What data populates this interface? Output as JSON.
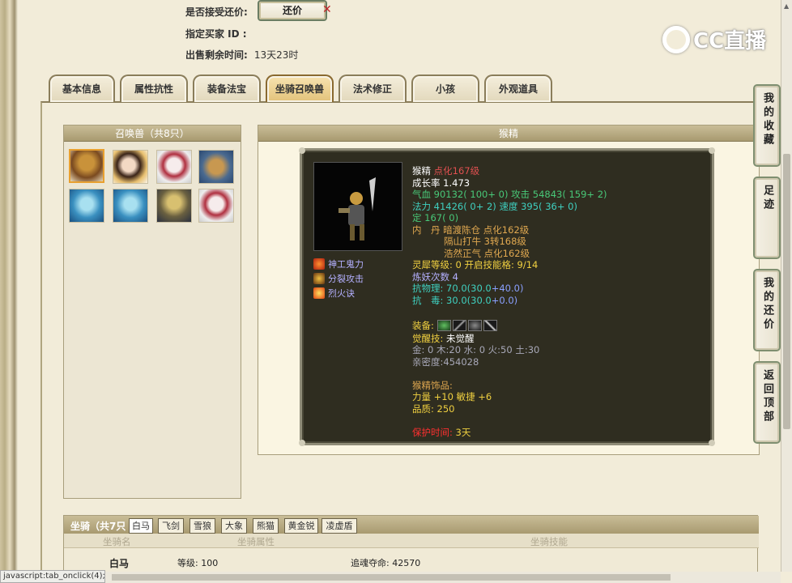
{
  "top": {
    "accept_bargain_label": "是否接受还价:",
    "bargain_button": "还价",
    "buyer_label": "指定买家 ID :",
    "remaining_label": "出售剩余时间:",
    "remaining_value": "13天23时"
  },
  "logo": {
    "text": "CC直播"
  },
  "tabs": [
    "基本信息",
    "属性抗性",
    "装备法宝",
    "坐骑召唤兽",
    "法术修正",
    "小孩",
    "外观道具"
  ],
  "active_tab": "坐骑召唤兽",
  "pet_list": {
    "title": "召唤兽（共8只）"
  },
  "detail": {
    "title": "猴精",
    "skills": [
      "神工鬼力",
      "分裂攻击",
      "烈火诀"
    ],
    "name": "猴精",
    "name_suffix": "点化167级",
    "growth": "成长率 1.473",
    "hp_label": "气血 ",
    "hp_value": "90132( 100+ 0)",
    "atk_label": " 攻击 ",
    "atk_value": "54843( 159+ 2)",
    "mp_label": "法力 ",
    "mp_value": "41426( 0+ 2)",
    "spd_label": " 速度 ",
    "spd_value": "395( 36+ 0)",
    "ding_label": "定 ",
    "ding_value": "167( 0)",
    "neidan_label": "内　丹 ",
    "neidan_1": "暗渡陈仓 点化162级",
    "neidan_2": "隔山打牛 3转168级",
    "neidan_3": "浩然正气 点化162级",
    "lingxi": "灵犀等级:  0 开启技能格:  9/14",
    "lianyao": "炼妖次数 4",
    "kangwuli_label": "抗物理: ",
    "kangwuli_base": "70.0(30.0",
    "kangwuli_plus": "+40.0)",
    "kangdu_label": "抗　毒: ",
    "kangdu_base": "30.0(30.0",
    "kangdu_plus": "+0.0)",
    "equip_label": "装备: ",
    "awaken_label": "觉醒技: ",
    "awaken_value": " 未觉醒",
    "elements": "金: 0 木:20 水: 0 火:50 土:30",
    "intimacy": "亲密度:454028",
    "ornament_label": "猴精饰品:",
    "ornament_bonus": "力量 +10 敏捷 +6",
    "ornament_quality": "品质:  250",
    "protect_label": "保护时间: ",
    "protect_value": "3天"
  },
  "side_nav": [
    "我的收藏",
    "足迹",
    "我的还价",
    "返回顶部"
  ],
  "mounts": {
    "title": "坐骑（共7只",
    "tabs": [
      "白马",
      "飞剑",
      "雪狼",
      "大象",
      "熊猫",
      "黄金锐",
      "凌虚盾"
    ],
    "active": "白马",
    "columns": [
      "坐骑名",
      "坐骑属性",
      "坐骑技能"
    ],
    "row": {
      "name": "白马",
      "level": "等级: 100",
      "skill": "追魂夺命: 42570"
    }
  },
  "status": {
    "url": "javascript:tab_onclick(4);"
  },
  "colors": {
    "accent": "#e3c27a",
    "card_bg": "#2f2d20",
    "header_bg": "#a89a70"
  }
}
